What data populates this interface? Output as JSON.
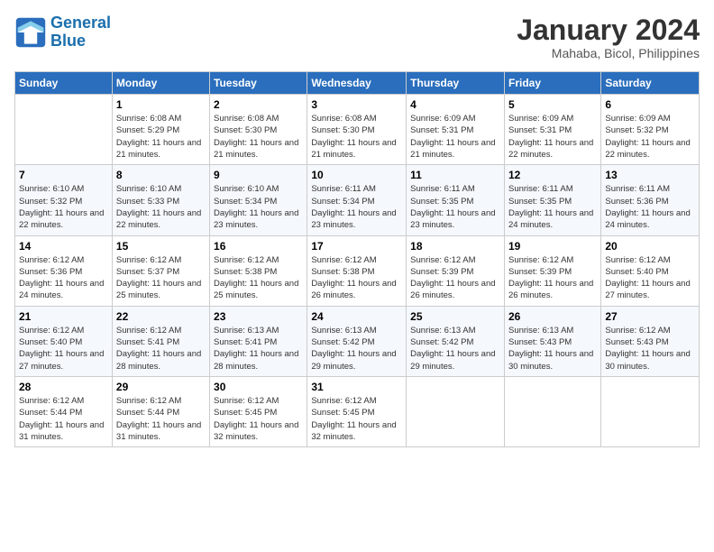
{
  "logo": {
    "line1": "General",
    "line2": "Blue"
  },
  "title": "January 2024",
  "subtitle": "Mahaba, Bicol, Philippines",
  "days_of_week": [
    "Sunday",
    "Monday",
    "Tuesday",
    "Wednesday",
    "Thursday",
    "Friday",
    "Saturday"
  ],
  "weeks": [
    [
      {
        "day": "",
        "sunrise": "",
        "sunset": "",
        "daylight": "",
        "empty": true
      },
      {
        "day": "1",
        "sunrise": "Sunrise: 6:08 AM",
        "sunset": "Sunset: 5:29 PM",
        "daylight": "Daylight: 11 hours and 21 minutes."
      },
      {
        "day": "2",
        "sunrise": "Sunrise: 6:08 AM",
        "sunset": "Sunset: 5:30 PM",
        "daylight": "Daylight: 11 hours and 21 minutes."
      },
      {
        "day": "3",
        "sunrise": "Sunrise: 6:08 AM",
        "sunset": "Sunset: 5:30 PM",
        "daylight": "Daylight: 11 hours and 21 minutes."
      },
      {
        "day": "4",
        "sunrise": "Sunrise: 6:09 AM",
        "sunset": "Sunset: 5:31 PM",
        "daylight": "Daylight: 11 hours and 21 minutes."
      },
      {
        "day": "5",
        "sunrise": "Sunrise: 6:09 AM",
        "sunset": "Sunset: 5:31 PM",
        "daylight": "Daylight: 11 hours and 22 minutes."
      },
      {
        "day": "6",
        "sunrise": "Sunrise: 6:09 AM",
        "sunset": "Sunset: 5:32 PM",
        "daylight": "Daylight: 11 hours and 22 minutes."
      }
    ],
    [
      {
        "day": "7",
        "sunrise": "Sunrise: 6:10 AM",
        "sunset": "Sunset: 5:32 PM",
        "daylight": "Daylight: 11 hours and 22 minutes."
      },
      {
        "day": "8",
        "sunrise": "Sunrise: 6:10 AM",
        "sunset": "Sunset: 5:33 PM",
        "daylight": "Daylight: 11 hours and 22 minutes."
      },
      {
        "day": "9",
        "sunrise": "Sunrise: 6:10 AM",
        "sunset": "Sunset: 5:34 PM",
        "daylight": "Daylight: 11 hours and 23 minutes."
      },
      {
        "day": "10",
        "sunrise": "Sunrise: 6:11 AM",
        "sunset": "Sunset: 5:34 PM",
        "daylight": "Daylight: 11 hours and 23 minutes."
      },
      {
        "day": "11",
        "sunrise": "Sunrise: 6:11 AM",
        "sunset": "Sunset: 5:35 PM",
        "daylight": "Daylight: 11 hours and 23 minutes."
      },
      {
        "day": "12",
        "sunrise": "Sunrise: 6:11 AM",
        "sunset": "Sunset: 5:35 PM",
        "daylight": "Daylight: 11 hours and 24 minutes."
      },
      {
        "day": "13",
        "sunrise": "Sunrise: 6:11 AM",
        "sunset": "Sunset: 5:36 PM",
        "daylight": "Daylight: 11 hours and 24 minutes."
      }
    ],
    [
      {
        "day": "14",
        "sunrise": "Sunrise: 6:12 AM",
        "sunset": "Sunset: 5:36 PM",
        "daylight": "Daylight: 11 hours and 24 minutes."
      },
      {
        "day": "15",
        "sunrise": "Sunrise: 6:12 AM",
        "sunset": "Sunset: 5:37 PM",
        "daylight": "Daylight: 11 hours and 25 minutes."
      },
      {
        "day": "16",
        "sunrise": "Sunrise: 6:12 AM",
        "sunset": "Sunset: 5:38 PM",
        "daylight": "Daylight: 11 hours and 25 minutes."
      },
      {
        "day": "17",
        "sunrise": "Sunrise: 6:12 AM",
        "sunset": "Sunset: 5:38 PM",
        "daylight": "Daylight: 11 hours and 26 minutes."
      },
      {
        "day": "18",
        "sunrise": "Sunrise: 6:12 AM",
        "sunset": "Sunset: 5:39 PM",
        "daylight": "Daylight: 11 hours and 26 minutes."
      },
      {
        "day": "19",
        "sunrise": "Sunrise: 6:12 AM",
        "sunset": "Sunset: 5:39 PM",
        "daylight": "Daylight: 11 hours and 26 minutes."
      },
      {
        "day": "20",
        "sunrise": "Sunrise: 6:12 AM",
        "sunset": "Sunset: 5:40 PM",
        "daylight": "Daylight: 11 hours and 27 minutes."
      }
    ],
    [
      {
        "day": "21",
        "sunrise": "Sunrise: 6:12 AM",
        "sunset": "Sunset: 5:40 PM",
        "daylight": "Daylight: 11 hours and 27 minutes."
      },
      {
        "day": "22",
        "sunrise": "Sunrise: 6:12 AM",
        "sunset": "Sunset: 5:41 PM",
        "daylight": "Daylight: 11 hours and 28 minutes."
      },
      {
        "day": "23",
        "sunrise": "Sunrise: 6:13 AM",
        "sunset": "Sunset: 5:41 PM",
        "daylight": "Daylight: 11 hours and 28 minutes."
      },
      {
        "day": "24",
        "sunrise": "Sunrise: 6:13 AM",
        "sunset": "Sunset: 5:42 PM",
        "daylight": "Daylight: 11 hours and 29 minutes."
      },
      {
        "day": "25",
        "sunrise": "Sunrise: 6:13 AM",
        "sunset": "Sunset: 5:42 PM",
        "daylight": "Daylight: 11 hours and 29 minutes."
      },
      {
        "day": "26",
        "sunrise": "Sunrise: 6:13 AM",
        "sunset": "Sunset: 5:43 PM",
        "daylight": "Daylight: 11 hours and 30 minutes."
      },
      {
        "day": "27",
        "sunrise": "Sunrise: 6:12 AM",
        "sunset": "Sunset: 5:43 PM",
        "daylight": "Daylight: 11 hours and 30 minutes."
      }
    ],
    [
      {
        "day": "28",
        "sunrise": "Sunrise: 6:12 AM",
        "sunset": "Sunset: 5:44 PM",
        "daylight": "Daylight: 11 hours and 31 minutes."
      },
      {
        "day": "29",
        "sunrise": "Sunrise: 6:12 AM",
        "sunset": "Sunset: 5:44 PM",
        "daylight": "Daylight: 11 hours and 31 minutes."
      },
      {
        "day": "30",
        "sunrise": "Sunrise: 6:12 AM",
        "sunset": "Sunset: 5:45 PM",
        "daylight": "Daylight: 11 hours and 32 minutes."
      },
      {
        "day": "31",
        "sunrise": "Sunrise: 6:12 AM",
        "sunset": "Sunset: 5:45 PM",
        "daylight": "Daylight: 11 hours and 32 minutes."
      },
      {
        "day": "",
        "empty": true
      },
      {
        "day": "",
        "empty": true
      },
      {
        "day": "",
        "empty": true
      }
    ]
  ]
}
